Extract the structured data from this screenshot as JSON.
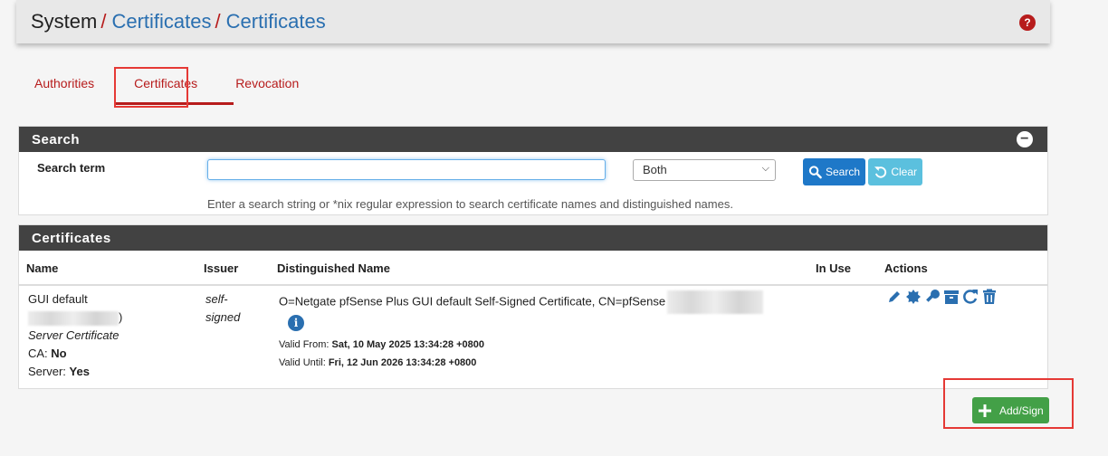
{
  "breadcrumb": {
    "root": "System",
    "sep": "/",
    "level1": "Certificates",
    "level2": "Certificates"
  },
  "help_icon_label": "?",
  "tabs": [
    {
      "label": "Authorities"
    },
    {
      "label": "Certificates",
      "active": true
    },
    {
      "label": "Revocation"
    }
  ],
  "search_panel": {
    "title": "Search",
    "term_label": "Search term",
    "term_value": "",
    "scope_selected": "Both",
    "search_button": "Search",
    "clear_button": "Clear",
    "help_text": "Enter a search string or *nix regular expression to search certificate names and distinguished names."
  },
  "cert_panel": {
    "title": "Certificates",
    "columns": {
      "name": "Name",
      "issuer": "Issuer",
      "dn": "Distinguished Name",
      "in_use": "In Use",
      "actions": "Actions"
    },
    "rows": [
      {
        "name_line1": "GUI default",
        "name_paren": ")",
        "type": "Server Certificate",
        "ca_label": "CA:",
        "ca_value": "No",
        "server_label": "Server:",
        "server_value": "Yes",
        "issuer_line1": "self-",
        "issuer_line2": "signed",
        "dn": "O=Netgate pfSense Plus GUI default Self-Signed Certificate, CN=pfSense",
        "valid_from_label": "Valid From:",
        "valid_from": "Sat, 10 May 2025 13:34:28 +0800",
        "valid_until_label": "Valid Until:",
        "valid_until": "Fri, 12 Jun 2026 13:34:28 +0800",
        "in_use": ""
      }
    ]
  },
  "add_button": "Add/Sign",
  "colors": {
    "accent_red": "#b71c1c",
    "link_blue": "#2a6fb0",
    "panel_dark": "#424242",
    "add_green": "#43a047"
  },
  "icons": [
    "help-icon",
    "collapse-icon",
    "search-icon",
    "undo-icon",
    "info-icon",
    "pencil-icon",
    "certificate-badge-icon",
    "key-icon",
    "archive-icon",
    "refresh-icon",
    "trash-icon",
    "plus-icon"
  ]
}
